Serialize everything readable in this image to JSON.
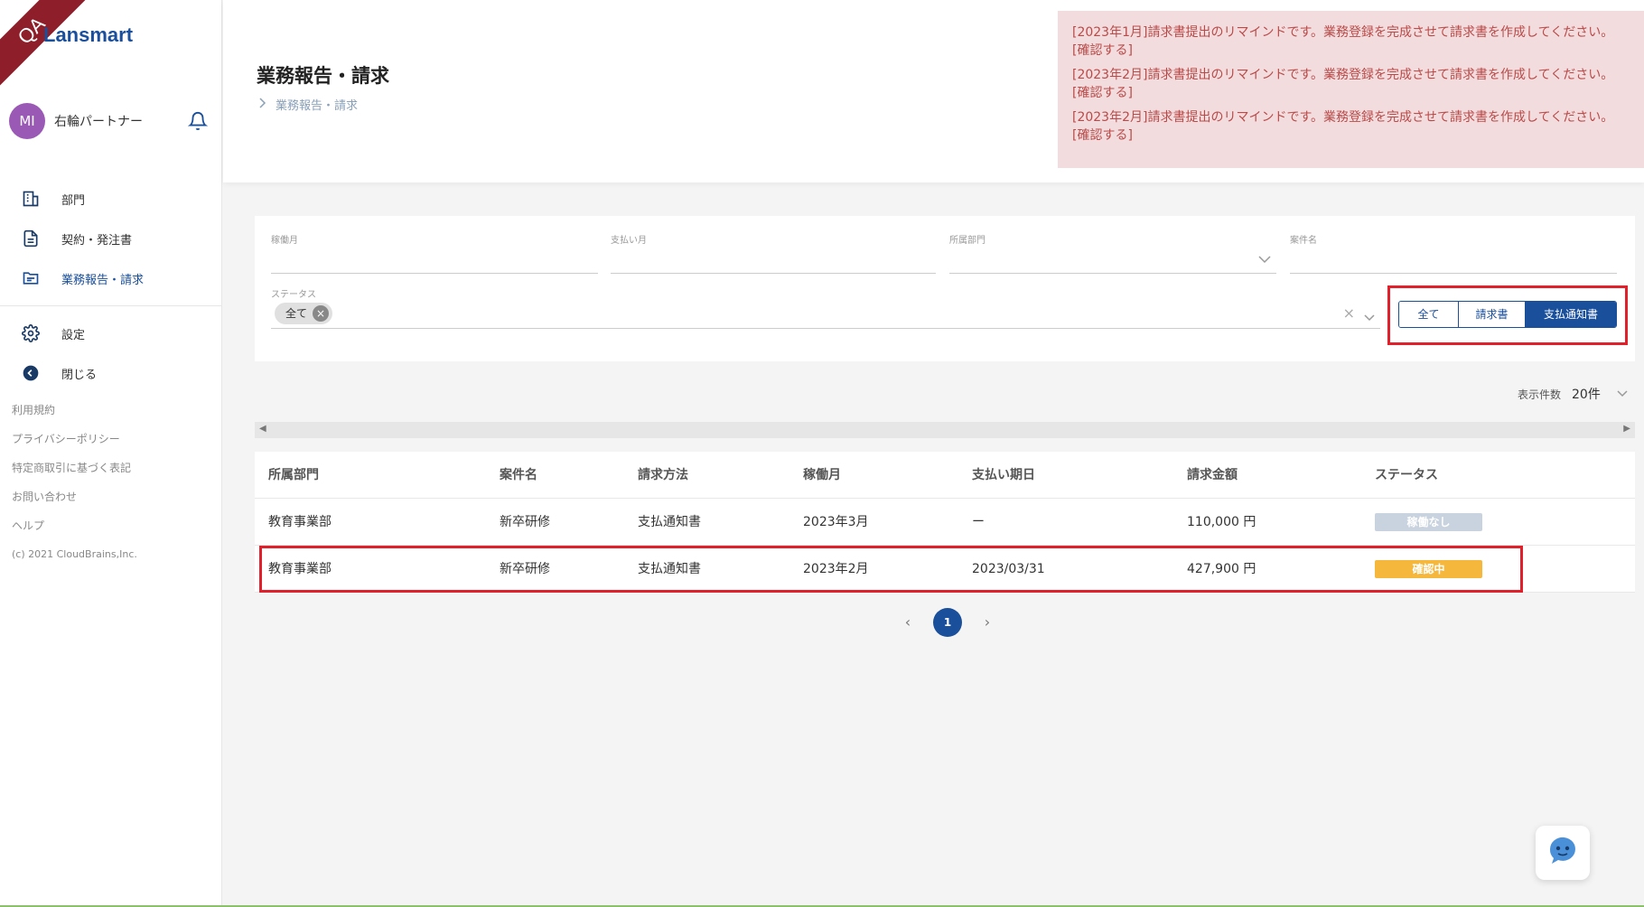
{
  "app": {
    "logo": "Lansmart",
    "qa_ribbon": "QA"
  },
  "user": {
    "initials": "MI",
    "name": "右輪パートナー"
  },
  "nav": {
    "items": [
      {
        "label": "部門",
        "icon": "building-icon"
      },
      {
        "label": "契約・発注書",
        "icon": "document-icon"
      },
      {
        "label": "業務報告・請求",
        "icon": "folder-icon",
        "active": true
      }
    ],
    "settings": {
      "label": "設定",
      "icon": "gear-icon"
    },
    "close": {
      "label": "閉じる",
      "icon": "arrow-left-circle-icon"
    }
  },
  "footer": {
    "links": [
      "利用規約",
      "プライバシーポリシー",
      "特定商取引に基づく表記",
      "お問い合わせ",
      "ヘルプ"
    ],
    "copyright": "(c) 2021 CloudBrains,Inc."
  },
  "header": {
    "title": "業務報告・請求",
    "breadcrumb": "業務報告・請求",
    "alerts": [
      "[2023年1月]請求書提出のリマインドです。業務登録を完成させて請求書を作成してください。[確認する]",
      "[2023年2月]請求書提出のリマインドです。業務登録を完成させて請求書を作成してください。[確認する]",
      "[2023年2月]請求書提出のリマインドです。業務登録を完成させて請求書を作成してください。[確認する]"
    ]
  },
  "filters": {
    "work_month": {
      "label": "稼働月",
      "value": ""
    },
    "pay_month": {
      "label": "支払い月",
      "value": ""
    },
    "department": {
      "label": "所属部門",
      "value": ""
    },
    "project": {
      "label": "案件名",
      "value": ""
    },
    "status": {
      "label": "ステータス",
      "chip": "全て"
    },
    "segments": [
      "全て",
      "請求書",
      "支払通知書"
    ],
    "segment_selected": "支払通知書"
  },
  "per_page": {
    "label": "表示件数",
    "value": "20件"
  },
  "table": {
    "headers": [
      "所属部門",
      "案件名",
      "請求方法",
      "稼働月",
      "支払い期日",
      "請求金額",
      "ステータス"
    ],
    "rows": [
      {
        "dept": "教育事業部",
        "project": "新卒研修",
        "method": "支払通知書",
        "month": "2023年3月",
        "due": "ー",
        "amount": "110,000 円",
        "status": "稼働なし",
        "status_color": "#c9d3df"
      },
      {
        "dept": "教育事業部",
        "project": "新卒研修",
        "method": "支払通知書",
        "month": "2023年2月",
        "due": "2023/03/31",
        "amount": "427,900 円",
        "status": "確認中",
        "status_color": "#f5b83d"
      }
    ]
  },
  "pagination": {
    "current": "1"
  },
  "colors": {
    "primary": "#1a4f9c",
    "alert_bg": "#f3dcde",
    "alert_text": "#b94a48",
    "highlight": "#e0202a"
  }
}
